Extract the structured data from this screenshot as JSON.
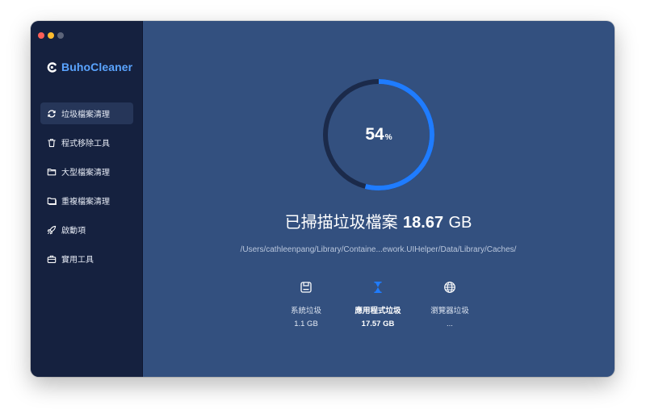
{
  "app": {
    "name": "BuhoCleaner"
  },
  "sidebar": {
    "items": [
      {
        "label": "垃圾檔案清理",
        "icon": "refresh-icon",
        "active": true
      },
      {
        "label": "程式移除工具",
        "icon": "trash-icon",
        "active": false
      },
      {
        "label": "大型檔案清理",
        "icon": "folder-icon",
        "active": false
      },
      {
        "label": "重複檔案清理",
        "icon": "duplicate-folder-icon",
        "active": false
      },
      {
        "label": "啟動項",
        "icon": "rocket-icon",
        "active": false
      },
      {
        "label": "實用工具",
        "icon": "toolbox-icon",
        "active": false
      }
    ]
  },
  "scan": {
    "progress_percent": 54,
    "percent_number": "54",
    "percent_unit": "%",
    "headline_prefix": "已掃描垃圾檔案",
    "total_size": "18.67",
    "total_unit": "GB",
    "current_path": "/Users/cathleenpang/Library/Containe...ework.UIHelper/Data/Library/Caches/"
  },
  "categories": [
    {
      "label": "系統垃圾",
      "value": "1.1 GB",
      "icon": "disk-icon",
      "active": false
    },
    {
      "label": "應用程式垃圾",
      "value": "17.57 GB",
      "icon": "hourglass-icon",
      "active": true
    },
    {
      "label": "瀏覽器垃圾",
      "value": "...",
      "icon": "globe-icon",
      "active": false
    }
  ],
  "colors": {
    "sidebar_bg": "#15213f",
    "main_bg": "#33507f",
    "accent": "#1f7cff",
    "ring_track": "#1b2a4a",
    "brand": "#5aa4ff"
  }
}
